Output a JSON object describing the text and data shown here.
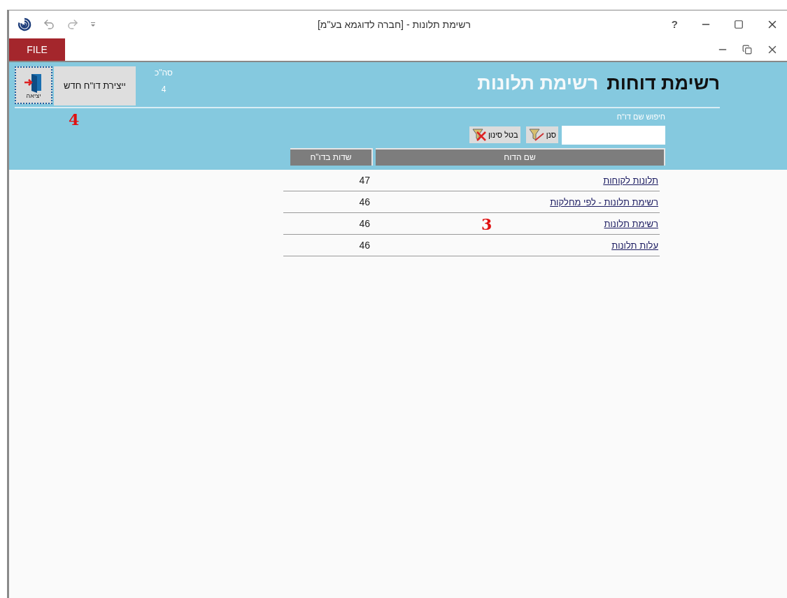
{
  "window": {
    "title": "רשימת תלונות -  [חברה לדוגמא בע\"מ]",
    "help": "?"
  },
  "ribbon": {
    "file_tab": "FILE"
  },
  "header": {
    "title": "רשימת דוחות",
    "subtitle": "רשימת תלונות",
    "total_label": "סה\"כ",
    "total_value": "4",
    "new_report_button": "ייצירת דו\"ח חדש",
    "exit_button": "יציאה"
  },
  "search": {
    "label": "חיפוש שם דו\"ח",
    "filter_button": "סנן",
    "clear_button": "בטל סינון"
  },
  "table": {
    "columns": [
      "שם הדוח",
      "שדות בדו\"ח"
    ],
    "rows": [
      {
        "name": "תלונות לקוחות",
        "fields": "47"
      },
      {
        "name": "רשימת תלונות  - לפי מחלקות",
        "fields": "46"
      },
      {
        "name": "רשימת תלונות",
        "fields": "46"
      },
      {
        "name": "עלות תלונות",
        "fields": "46"
      }
    ]
  },
  "callouts": [
    "4",
    "3"
  ]
}
